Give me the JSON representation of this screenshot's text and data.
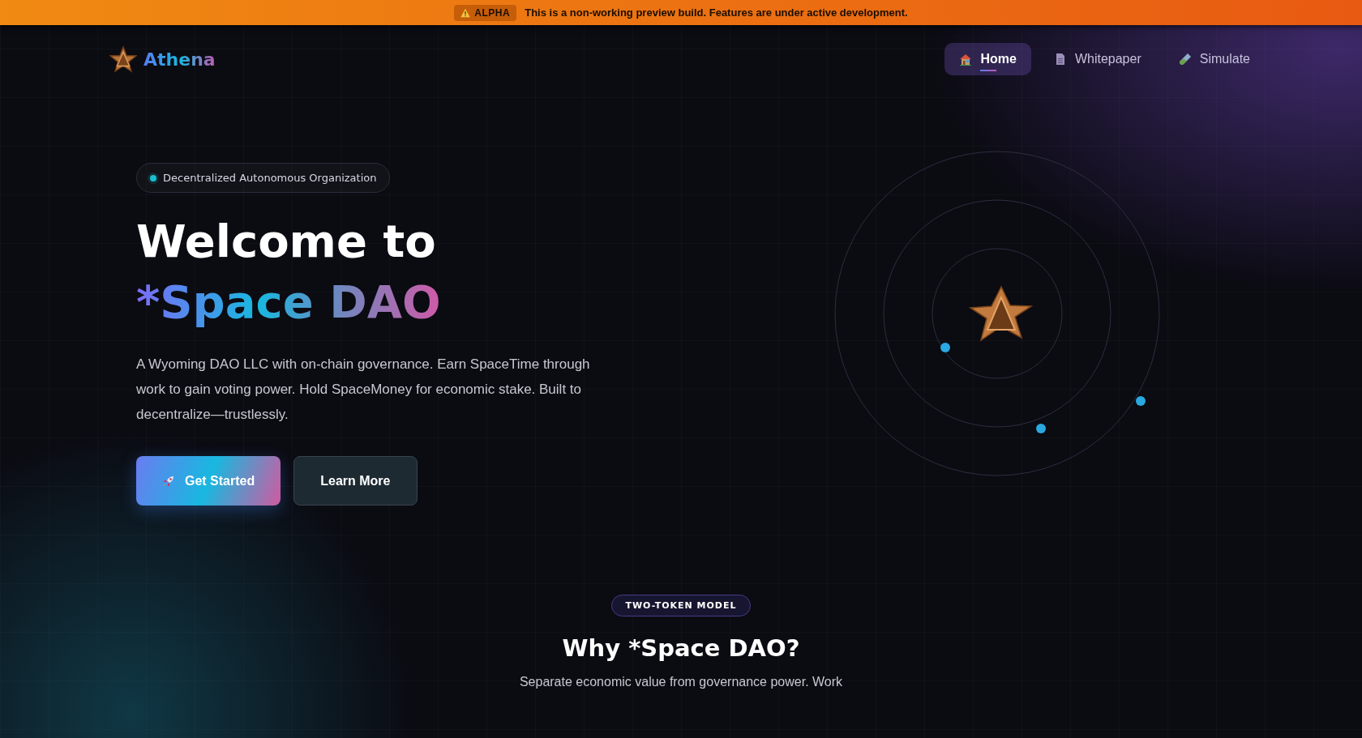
{
  "banner": {
    "tag": "ALPHA",
    "message": "This is a non-working preview build. Features are under active development."
  },
  "header": {
    "logo_text": "Athena",
    "nav": [
      {
        "label": "Home",
        "kind": "home",
        "selected": true
      },
      {
        "label": "Whitepaper",
        "kind": "doc",
        "selected": false
      },
      {
        "label": "Simulate",
        "kind": "tube",
        "selected": false
      }
    ]
  },
  "hero": {
    "badge": "Decentralized Autonomous Organization",
    "title_line1": "Welcome to",
    "title_line2": "*Space DAO",
    "description": "A Wyoming DAO LLC with on-chain governance. Earn SpaceTime through work to gain voting power. Hold SpaceMoney for economic stake. Built to decentralize—trustlessly.",
    "buttons": [
      {
        "label": "Get Started",
        "kind": "primary"
      },
      {
        "label": "Learn More",
        "kind": "secondary"
      }
    ]
  },
  "section": {
    "badge": "TWO-TOKEN MODEL",
    "title": "Why *Space DAO?",
    "text": "Separate economic value from governance power. Work"
  }
}
